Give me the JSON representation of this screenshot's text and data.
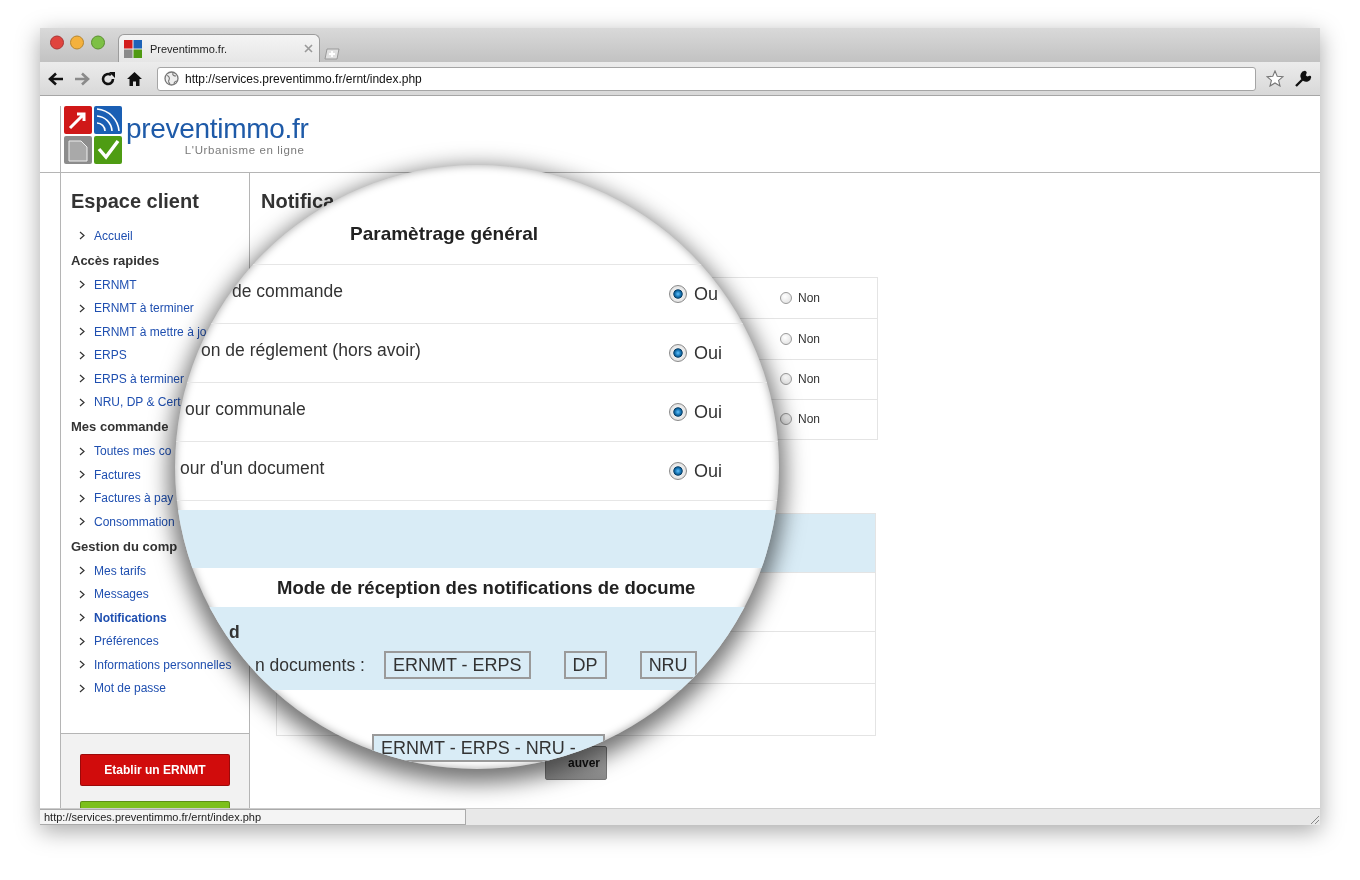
{
  "browser": {
    "tab_title": "Preventimmo.fr.",
    "address": "http://services.preventimmo.fr/ernt/index.php",
    "status_url": "http://services.preventimmo.fr/ernt/index.php"
  },
  "header": {
    "logo_text": "preventimmo.fr",
    "tagline": "L'Urbanisme en ligne"
  },
  "sidebar": {
    "title": "Espace client",
    "sections": [
      {
        "items": [
          {
            "label": "Accueil",
            "selected": false
          }
        ]
      },
      {
        "heading": "Accès rapides",
        "items": [
          {
            "label": "ERNMT",
            "selected": false
          },
          {
            "label": "ERNMT à terminer",
            "selected": false
          },
          {
            "label": "ERNMT à mettre à jo",
            "selected": false
          },
          {
            "label": "ERPS",
            "selected": false
          },
          {
            "label": "ERPS à terminer",
            "selected": false
          },
          {
            "label": "NRU, DP & Cert",
            "selected": false
          }
        ]
      },
      {
        "heading": "Mes commande",
        "items": [
          {
            "label": "Toutes mes co",
            "selected": false
          },
          {
            "label": "Factures",
            "selected": false
          },
          {
            "label": "Factures à pay",
            "selected": false
          },
          {
            "label": "Consommation",
            "selected": false
          }
        ]
      },
      {
        "heading": "Gestion du comp",
        "items": [
          {
            "label": "Mes tarifs",
            "selected": false
          },
          {
            "label": "Messages",
            "selected": false
          },
          {
            "label": "Notifications",
            "selected": true
          },
          {
            "label": "Préférences",
            "selected": false
          },
          {
            "label": "Informations personnelles",
            "selected": false
          },
          {
            "label": "Mot de passe",
            "selected": false
          }
        ]
      }
    ],
    "action_buttons": [
      {
        "label": "Etablir un ERNMT",
        "color": "#d10c0c"
      },
      {
        "color": "#7cc01c"
      }
    ]
  },
  "main": {
    "title": "Notifica",
    "general_rows": [
      {
        "option": "Non",
        "selected": false
      },
      {
        "option": "Non",
        "selected": false
      },
      {
        "option": "Non",
        "selected": false
      },
      {
        "option": "Non",
        "selected": false
      }
    ],
    "save_button": "auver"
  },
  "magnifier": {
    "heading": "Paramètrage général",
    "rows": [
      {
        "label": "de commande",
        "option": "Ou",
        "selected": true
      },
      {
        "label": "on de réglement (hors avoir)",
        "option": "Oui",
        "selected": true
      },
      {
        "label": "our communale",
        "option": "Oui",
        "selected": true
      },
      {
        "label": "our d'un document",
        "option": "Oui",
        "selected": true
      }
    ],
    "section_title": "Mode de réception des notifications de docume",
    "field_label": "d",
    "documents_label": "n documents :",
    "document_types": [
      {
        "label": "ERNMT - ERPS"
      },
      {
        "label": "DP"
      },
      {
        "label": "NRU"
      }
    ],
    "combined_value": "ERNMT - ERPS - NRU -"
  }
}
